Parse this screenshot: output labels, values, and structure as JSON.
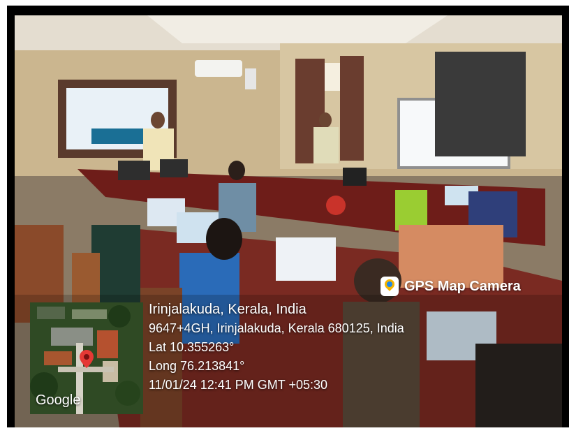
{
  "badge": {
    "title": "GPS Map Camera",
    "icon": "map-pin-icon"
  },
  "location": {
    "place": "Irinjalakuda, Kerala, India",
    "address": "9647+4GH, Irinjalakuda, Kerala 680125, India",
    "latitude": "Lat 10.355263°",
    "longitude": "Long 76.213841°",
    "timestamp": "11/01/24 12:41 PM GMT +05:30"
  },
  "map": {
    "provider_label": "Google",
    "pin_color": "#e53935"
  }
}
